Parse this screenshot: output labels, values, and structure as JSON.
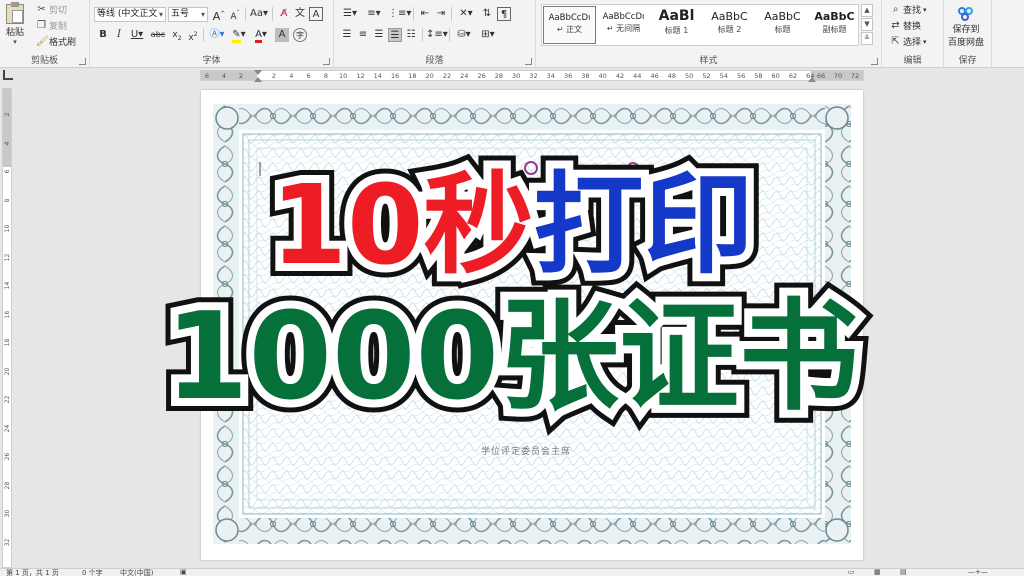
{
  "ribbon": {
    "clipboard": {
      "paste": "粘贴",
      "cut": "剪切",
      "copy": "复制",
      "format_painter": "格式刷",
      "group_label": "剪贴板"
    },
    "font": {
      "font_name": "等线 (中文正文",
      "font_size": "五号",
      "group_label": "字体"
    },
    "paragraph": {
      "group_label": "段落"
    },
    "styles": {
      "items": [
        {
          "sample": "AaBbCcDı",
          "name": "↵ 正文",
          "active": true
        },
        {
          "sample": "AaBbCcDı",
          "name": "↵ 无间隔",
          "active": false
        },
        {
          "sample": "AaBl",
          "name": "标题 1",
          "active": false
        },
        {
          "sample": "AaBbC",
          "name": "标题 2",
          "active": false
        },
        {
          "sample": "AaBbC",
          "name": "标题",
          "active": false
        },
        {
          "sample": "AaBbC",
          "name": "副标题",
          "active": false
        }
      ],
      "group_label": "样式"
    },
    "editing": {
      "find": "查找",
      "replace": "替换",
      "select": "选择",
      "group_label": "编辑"
    },
    "save": {
      "save_to_cloud_line1": "保存到",
      "save_to_cloud_line2": "百度网盘",
      "group_label": "保存"
    }
  },
  "ruler": {
    "left_ticks": [
      "6",
      "4",
      "2"
    ],
    "ticks": [
      "2",
      "4",
      "6",
      "8",
      "10",
      "12",
      "14",
      "16",
      "18",
      "20",
      "22",
      "24",
      "26",
      "28",
      "30",
      "32",
      "34",
      "36",
      "38",
      "40",
      "42",
      "44",
      "46",
      "48",
      "50",
      "52",
      "54",
      "56",
      "58",
      "60",
      "62",
      "64"
    ],
    "right_ticks": [
      "66",
      "70",
      "72"
    ],
    "vertical_ticks": [
      "2",
      "4",
      "6",
      "8",
      "10",
      "12",
      "14",
      "16",
      "18",
      "20",
      "22",
      "24",
      "26",
      "28",
      "30",
      "32"
    ]
  },
  "document": {
    "signature_line": "学位评定委员会主席"
  },
  "overlay": {
    "line1_part1": "10秒",
    "line1_part2": "打印",
    "line2_part1": "1000张证书"
  },
  "statusbar": {
    "page_info": "第 1 页，共 1 页",
    "word_count": "0 个字",
    "language": "中文(中国)"
  },
  "colors": {
    "overlay_red": "#ee1c24",
    "overlay_blue": "#1438c8",
    "overlay_green": "#06703a"
  }
}
